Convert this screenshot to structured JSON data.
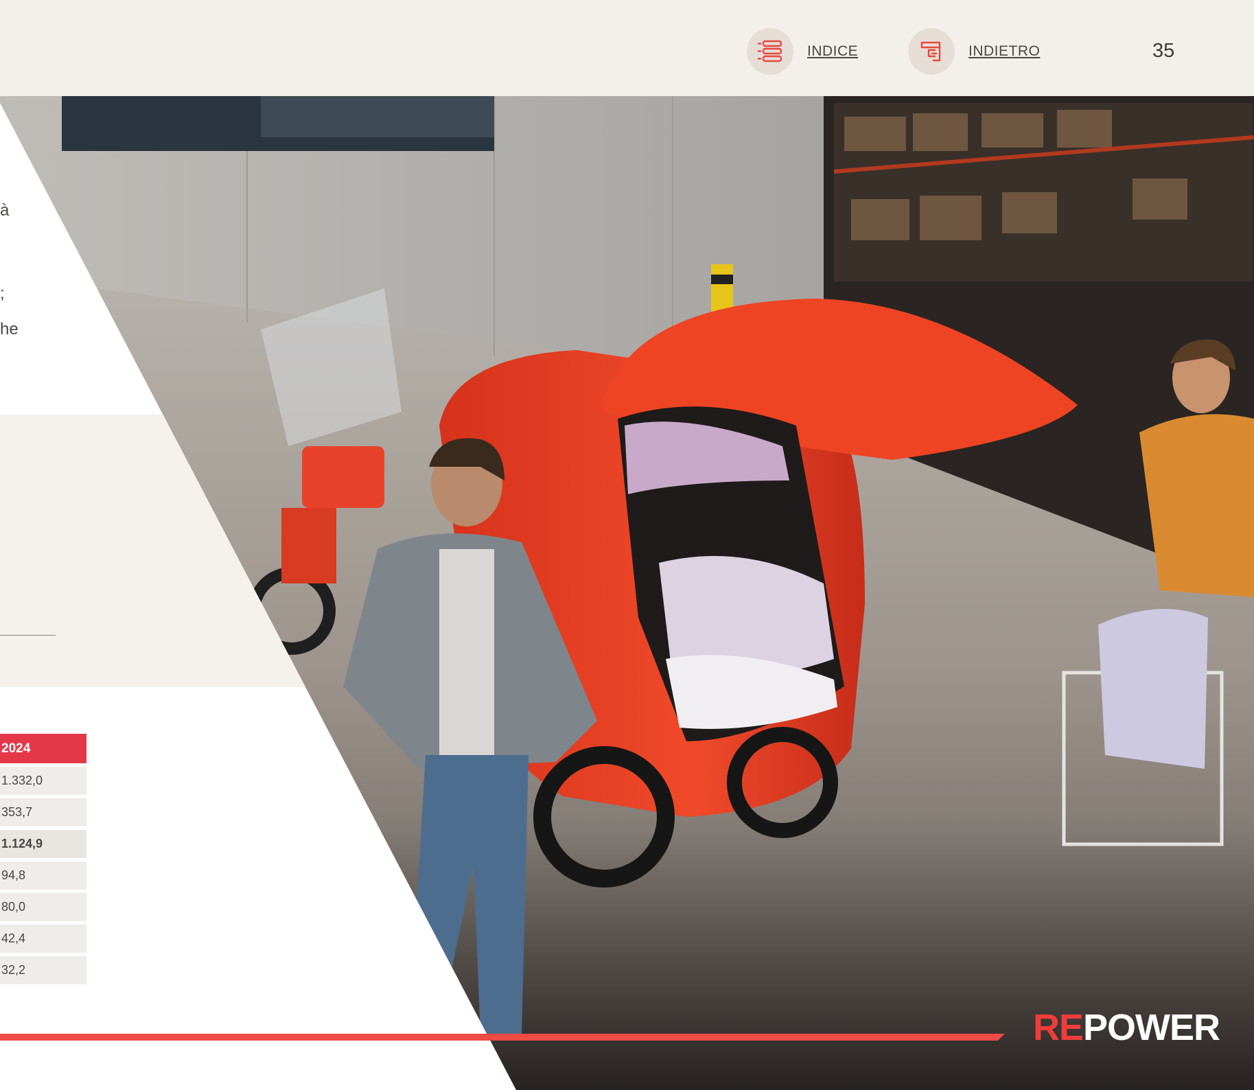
{
  "header": {
    "index_label": "INDICE",
    "back_label": "INDIETRO",
    "page_number": "35",
    "index_icon": "list-icon",
    "back_icon": "back-arrow-icon"
  },
  "left_text_fragments": [
    "à",
    ";",
    "he"
  ],
  "table": {
    "header": "2024",
    "rows": [
      "1.332,0",
      "353,7",
      "1.124,9",
      "94,8",
      "80,0",
      "42,4",
      "32,2"
    ]
  },
  "logo": {
    "re": "RE",
    "power": "POWER"
  },
  "colors": {
    "accent_red": "#e4384a",
    "line_red": "#f04a45",
    "beige": "#f4f1ed"
  }
}
